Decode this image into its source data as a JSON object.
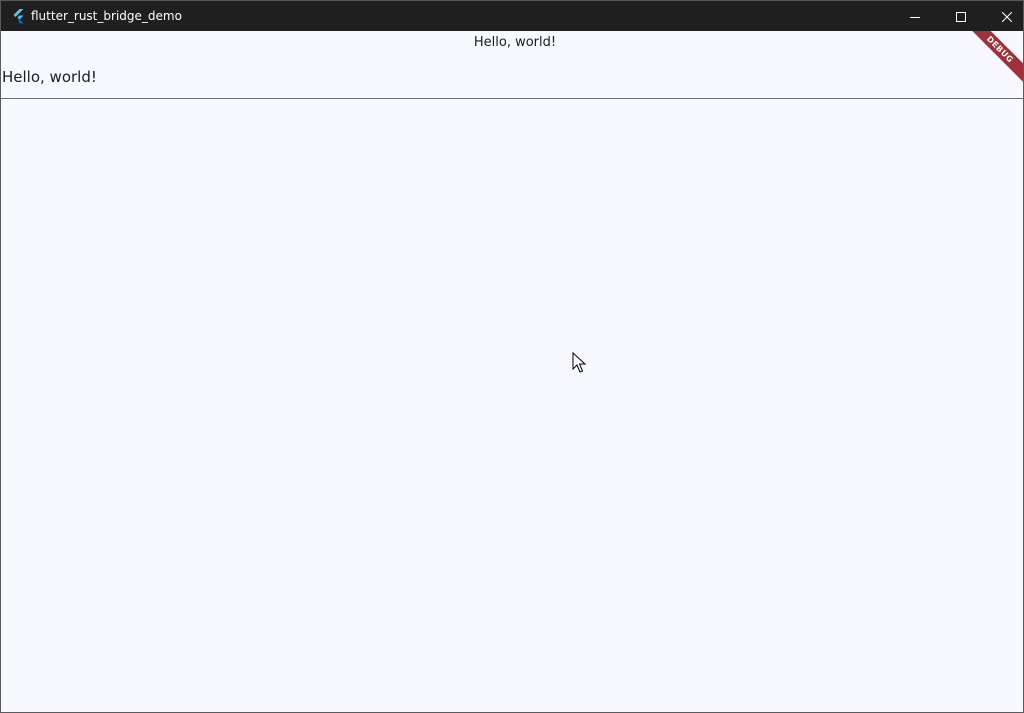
{
  "window": {
    "title": "flutter_rust_bridge_demo",
    "icon": "flutter-logo-icon",
    "controls": {
      "minimize_icon": "minimize-icon",
      "maximize_icon": "maximize-icon",
      "close_icon": "close-icon"
    }
  },
  "appbar": {
    "title": "Hello, world!"
  },
  "main": {
    "text": "Hello, world!"
  },
  "debug_banner": {
    "label": "DEBUG",
    "color": "#a0303a"
  },
  "colors": {
    "titlebar_bg": "#1f1f1f",
    "content_bg": "#f8f9fe",
    "text": "#1c1b1f"
  }
}
